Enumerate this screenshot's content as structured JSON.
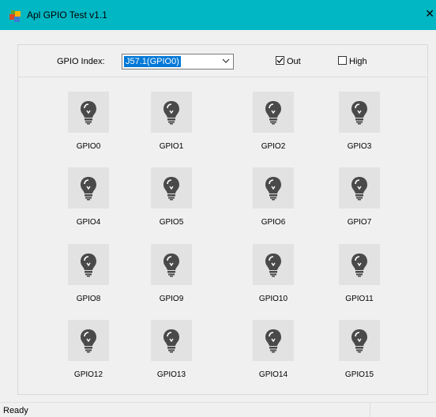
{
  "window": {
    "title": "Apl GPIO Test v1.1",
    "close_glyph": "✕"
  },
  "header": {
    "gpio_index_label": "GPIO Index:",
    "gpio_index_value": "J57.1(GPIO0)",
    "out_label": "Out",
    "out_checked": true,
    "high_label": "High",
    "high_checked": false
  },
  "gpios": [
    {
      "label": "GPIO0"
    },
    {
      "label": "GPIO1"
    },
    {
      "label": "GPIO2"
    },
    {
      "label": "GPIO3"
    },
    {
      "label": "GPIO4"
    },
    {
      "label": "GPIO5"
    },
    {
      "label": "GPIO6"
    },
    {
      "label": "GPIO7"
    },
    {
      "label": "GPIO8"
    },
    {
      "label": "GPIO9"
    },
    {
      "label": "GPIO10"
    },
    {
      "label": "GPIO11"
    },
    {
      "label": "GPIO12"
    },
    {
      "label": "GPIO13"
    },
    {
      "label": "GPIO14"
    },
    {
      "label": "GPIO15"
    }
  ],
  "status": {
    "text": "Ready"
  },
  "icons": {
    "gpio_icon": "lightbulb-icon",
    "app_icon": "app-icon"
  },
  "colors": {
    "titlebar": "#00b7c3",
    "selection": "#0078d7"
  }
}
